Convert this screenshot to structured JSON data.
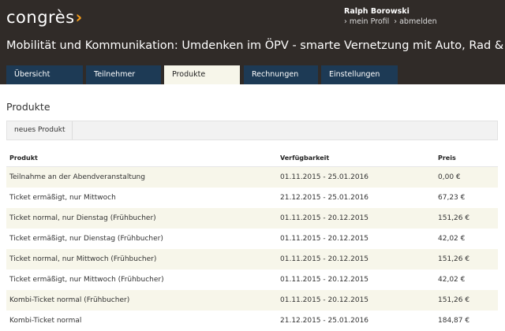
{
  "header": {
    "logo_text": "congrès",
    "logo_mark": "›",
    "user": {
      "name": "Ralph Borowski",
      "links": [
        {
          "label": "› mein Profil"
        },
        {
          "label": "› abmelden"
        }
      ]
    },
    "title": "Mobilität und Kommunikation: Umdenken im ÖPV - smarte Vernetzung mit Auto, Rad & Co.",
    "tabs": [
      {
        "label": "Übersicht"
      },
      {
        "label": "Teilnehmer"
      },
      {
        "label": "Produkte",
        "active": true
      },
      {
        "label": "Rechnungen"
      },
      {
        "label": "Einstellungen"
      }
    ]
  },
  "main": {
    "section_title": "Produkte",
    "toolbar": {
      "new_product_label": "neues Produkt"
    },
    "table": {
      "columns": [
        "Produkt",
        "Verfügbarkeit",
        "Preis"
      ],
      "rows": [
        {
          "product": "Teilnahme an der Abendveranstaltung",
          "availability": "01.11.2015 - 25.01.2016",
          "price": "0,00 €"
        },
        {
          "product": "Ticket ermäßigt, nur Mittwoch",
          "availability": "21.12.2015 - 25.01.2016",
          "price": "67,23 €"
        },
        {
          "product": "Ticket normal, nur Dienstag (Frühbucher)",
          "availability": "01.11.2015 - 20.12.2015",
          "price": "151,26 €"
        },
        {
          "product": "Ticket ermäßigt, nur Dienstag (Frühbucher)",
          "availability": "01.11.2015 - 20.12.2015",
          "price": "42,02 €"
        },
        {
          "product": "Ticket normal, nur Mittwoch (Frühbucher)",
          "availability": "01.11.2015 - 20.12.2015",
          "price": "151,26 €"
        },
        {
          "product": "Ticket ermäßigt, nur Mittwoch (Frühbucher)",
          "availability": "01.11.2015 - 20.12.2015",
          "price": "42,02 €"
        },
        {
          "product": "Kombi-Ticket normal (Frühbucher)",
          "availability": "01.11.2015 - 20.12.2015",
          "price": "151,26 €"
        },
        {
          "product": "Kombi-Ticket normal",
          "availability": "21.12.2015 - 25.01.2016",
          "price": "184,87 €"
        }
      ]
    }
  },
  "colors": {
    "header_bg": "#302b28",
    "tab_bg": "#1d3a55",
    "tab_active_bg": "#f7f6ea",
    "logo_accent": "#f39c1c",
    "row_stripe": "#f7f6ea"
  }
}
